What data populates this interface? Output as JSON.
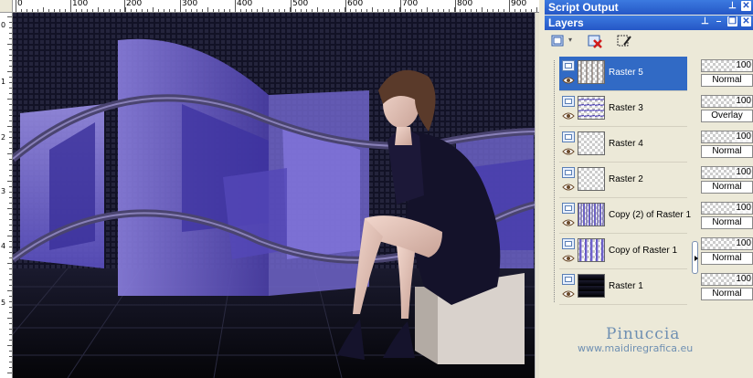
{
  "ruler": {
    "top_labels": [
      "0",
      "100",
      "200",
      "300",
      "400",
      "500",
      "600",
      "700",
      "800",
      "900"
    ],
    "left_labels": [
      "0",
      "1",
      "2",
      "3",
      "4",
      "5"
    ]
  },
  "panels": {
    "script_output": {
      "title": "Script Output"
    },
    "layers": {
      "title": "Layers"
    }
  },
  "layers": [
    {
      "name": "Raster 5",
      "opacity": "100",
      "blend": "Normal",
      "selected": true
    },
    {
      "name": "Raster 3",
      "opacity": "100",
      "blend": "Overlay",
      "selected": false
    },
    {
      "name": "Raster 4",
      "opacity": "100",
      "blend": "Normal",
      "selected": false
    },
    {
      "name": "Raster 2",
      "opacity": "100",
      "blend": "Normal",
      "selected": false
    },
    {
      "name": "Copy (2) of Raster 1",
      "opacity": "100",
      "blend": "Normal",
      "selected": false
    },
    {
      "name": "Copy of Raster 1",
      "opacity": "100",
      "blend": "Normal",
      "selected": false
    },
    {
      "name": "Raster 1",
      "opacity": "100",
      "blend": "Normal",
      "selected": false
    }
  ],
  "watermark": {
    "name": "Pinuccia",
    "url": "www.maidiregrafica.eu"
  },
  "colors": {
    "accent": "#6a5acd",
    "selection": "#316ac5",
    "titlebar": "#2557c6"
  },
  "icons": [
    "new-layer-icon",
    "delete-layer-icon",
    "layer-properties-icon",
    "visibility-icon",
    "eye-icon",
    "pin-icon",
    "close-icon",
    "minimize-icon",
    "restore-icon"
  ]
}
